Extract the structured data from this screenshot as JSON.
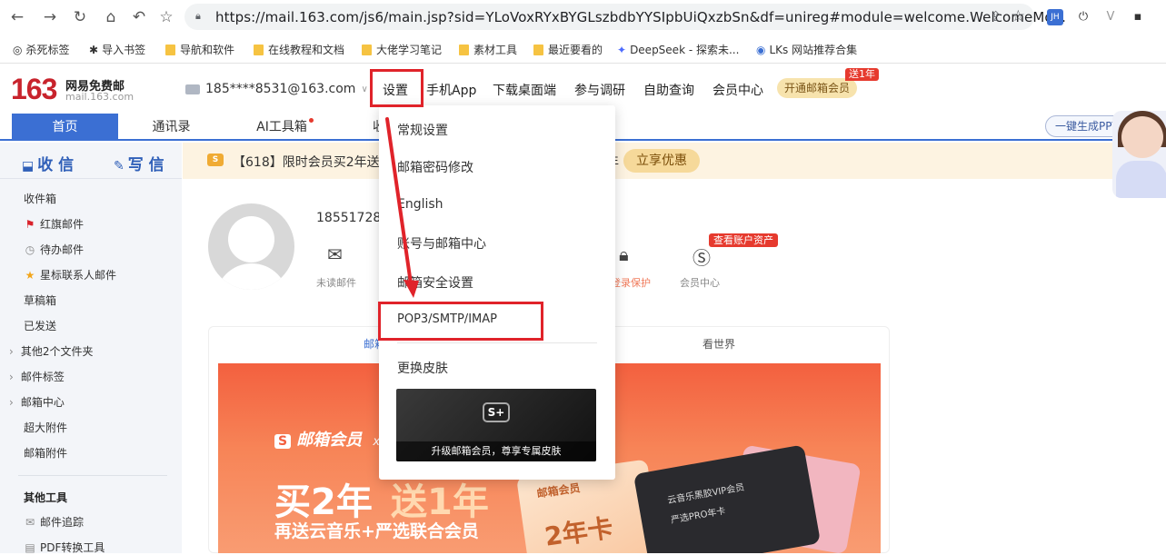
{
  "browser": {
    "url": "https://mail.163.com/js6/main.jsp?sid=YLoVoxRYxBYGLszbdbYYSIpbUiQxzbSn&df=unireg#module=welcome.WelcomeMo...",
    "extensions": [
      "JH",
      "⏻",
      "V",
      "▪"
    ]
  },
  "bookmarks": [
    {
      "label": "杀死标签"
    },
    {
      "label": "导入书签"
    },
    {
      "label": "导航和软件"
    },
    {
      "label": "在线教程和文档"
    },
    {
      "label": "大佬学习笔记"
    },
    {
      "label": "素材工具"
    },
    {
      "label": "最近要看的"
    },
    {
      "label": "DeepSeek - 探索未..."
    },
    {
      "label": "LKs 网站推荐合集"
    }
  ],
  "header": {
    "logo_number": "163",
    "logo_title": "网易免费邮",
    "logo_domain": "mail.163.com",
    "account": "185****8531@163.com",
    "nav": [
      "设置",
      "手机App",
      "下载桌面端",
      "参与调研",
      "自助查询",
      "会员中心"
    ],
    "vip_button": "开通邮箱会员",
    "vip_tag": "送1年"
  },
  "tabs": [
    {
      "label": "首页"
    },
    {
      "label": "通讯录"
    },
    {
      "label": "AI工具箱"
    },
    {
      "label": "收"
    }
  ],
  "ppt_button": "一键生成PPT",
  "sidebar": {
    "receive": "收 信",
    "write": "写 信",
    "folders": [
      {
        "label": "收件箱",
        "icon": ""
      },
      {
        "label": "红旗邮件",
        "icon": "flag-icon"
      },
      {
        "label": "待办邮件",
        "icon": "clock-icon"
      },
      {
        "label": "星标联系人邮件",
        "icon": "star-icon"
      },
      {
        "label": "草稿箱",
        "icon": ""
      },
      {
        "label": "已发送",
        "icon": ""
      }
    ],
    "expandable": [
      "其他2个文件夹",
      "邮件标签",
      "邮箱中心"
    ],
    "more": [
      "超大附件",
      "邮箱附件"
    ],
    "tools_title": "其他工具",
    "tools": [
      "邮件追踪",
      "PDF转换工具"
    ]
  },
  "banner": {
    "text": "【618】限时会员买2年送1",
    "suffix": "年",
    "button": "立享优惠"
  },
  "profile": {
    "name": "18551728",
    "stats": [
      {
        "label": "未读邮件"
      },
      {
        "label": "登录保护"
      },
      {
        "label": "会员中心"
      }
    ],
    "asset_tag": "查看账户资产"
  },
  "card": {
    "tab_left": "邮箱",
    "tab_right": "看世界"
  },
  "promo": {
    "brand": "邮箱会员",
    "brand_x": "x",
    "headline_a": "买2年",
    "headline_b": "送1年",
    "sub": "再送云音乐+严选联合会员",
    "ticket_brand": "邮箱会员",
    "ticket_main": "2年卡",
    "card_line1": "云音乐黑胶VIP会员",
    "card_line2": "严选PRO年卡"
  },
  "dropdown": {
    "items": [
      "常规设置",
      "邮箱密码修改",
      "English",
      "账号与邮箱中心",
      "邮箱安全设置",
      "POP3/SMTP/IMAP"
    ],
    "skin_label": "更换皮肤",
    "skin_logo": "S+",
    "skin_caption": "升级邮箱会员，尊享专属皮肤"
  },
  "colors": {
    "brand_red": "#c8232c",
    "accent_blue": "#3b6fd3",
    "annotation_red": "#e0232a"
  }
}
